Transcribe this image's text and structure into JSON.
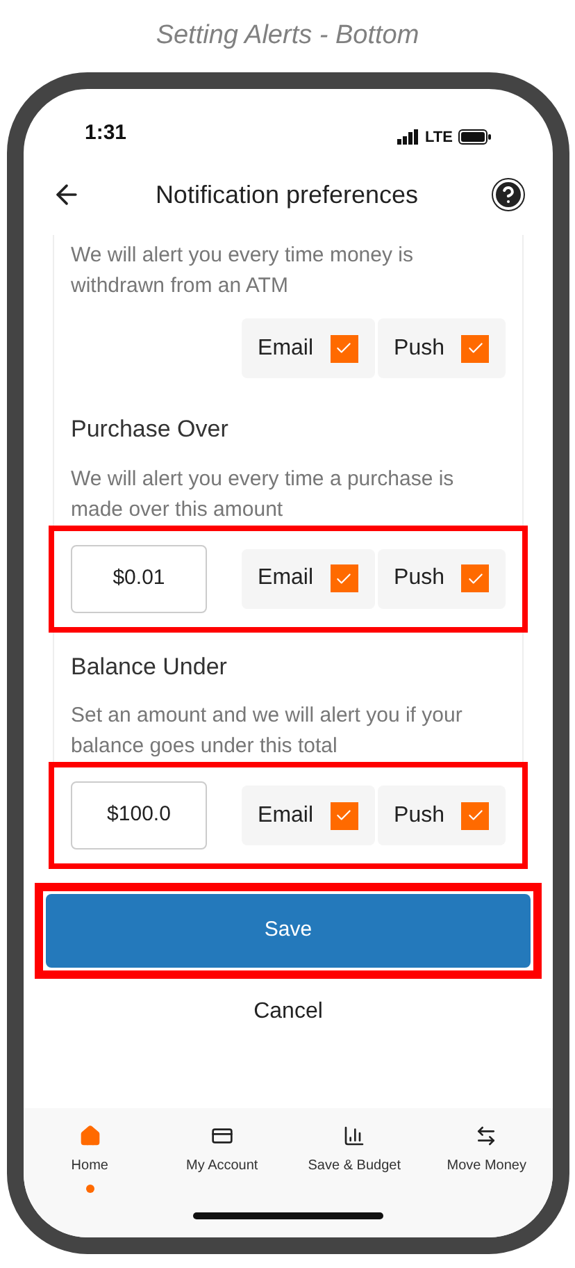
{
  "caption": "Setting Alerts - Bottom",
  "status_bar": {
    "time": "1:31",
    "network": "LTE"
  },
  "header": {
    "title": "Notification preferences"
  },
  "alerts": [
    {
      "description": "We will alert you every time money is withdrawn from an ATM",
      "highlighted": false,
      "options": [
        {
          "label": "Email",
          "checked": true
        },
        {
          "label": "Push",
          "checked": true
        }
      ]
    },
    {
      "title": "Purchase Over",
      "description": "We will alert you every time a purchase is made over this amount",
      "amount": "$0.01",
      "highlighted": true,
      "options": [
        {
          "label": "Email",
          "checked": true
        },
        {
          "label": "Push",
          "checked": true
        }
      ]
    },
    {
      "title": "Balance Under",
      "description": "Set an amount and we will alert you if your balance goes under this total",
      "amount": "$100.0",
      "highlighted": true,
      "options": [
        {
          "label": "Email",
          "checked": true
        },
        {
          "label": "Push",
          "checked": true
        }
      ]
    }
  ],
  "save": {
    "label": "Save",
    "highlighted": true
  },
  "cancel": {
    "label": "Cancel"
  },
  "nav": [
    {
      "kind": "home",
      "label": "Home",
      "selected": true
    },
    {
      "kind": "account",
      "label": "My Account",
      "selected": false
    },
    {
      "kind": "budget",
      "label": "Save & Budget",
      "selected": false
    },
    {
      "kind": "transfer",
      "label": "Move Money",
      "selected": false
    }
  ]
}
